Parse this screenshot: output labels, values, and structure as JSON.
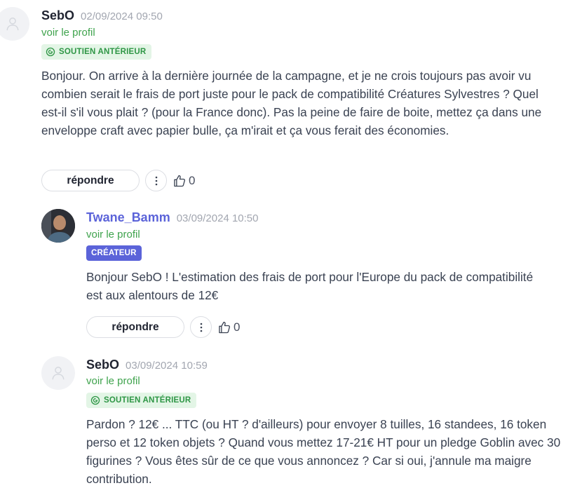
{
  "comments": [
    {
      "author": "SebO",
      "date": "02/09/2024 09:50",
      "profile_link": "voir le profil",
      "badge": "SOUTIEN ANTÉRIEUR",
      "body": "Bonjour. On arrive à la dernière journée de la campagne, et je ne crois toujours pas avoir vu combien serait le frais de port juste pour le pack de compatibilité Créatures Sylvestres ? Quel est-il s'il vous plait ? (pour la France donc). Pas la peine de faire de boite, mettez ça dans une enveloppe craft avec papier bulle, ça m'irait et ça vous ferait des économies.",
      "reply_label": "répondre",
      "likes": "0"
    },
    {
      "author": "Twane_Bamm",
      "date": "03/09/2024 10:50",
      "profile_link": "voir le profil",
      "badge": "CRÉATEUR",
      "body": "Bonjour SebO ! L'estimation des frais de port pour l'Europe du pack de compatibilité est aux alentours de 12€",
      "reply_label": "répondre",
      "likes": "0"
    },
    {
      "author": "SebO",
      "date": "03/09/2024 10:59",
      "profile_link": "voir le profil",
      "badge": "SOUTIEN ANTÉRIEUR",
      "body": "Pardon ? 12€ ... TTC (ou HT ? d'ailleurs) pour envoyer 8 tuilles, 16 standees, 16 token perso et 12 token objets ? Quand vous mettez 17-21€ HT pour un pledge Goblin avec 30 figurines ? Vous êtes sûr de ce que vous annoncez ? Car si oui, j'annule ma maigre contribution."
    }
  ],
  "colors": {
    "creator_accent": "#5b63d9",
    "backer_green": "#2e9645",
    "backer_bg": "#e3f5e6",
    "link_green": "#3fa34d"
  },
  "icons": {
    "default_avatar": "user-silhouette-icon",
    "backer_badge": "refresh-circle-icon",
    "more": "vertical-dots-icon",
    "like": "thumbs-up-icon"
  }
}
